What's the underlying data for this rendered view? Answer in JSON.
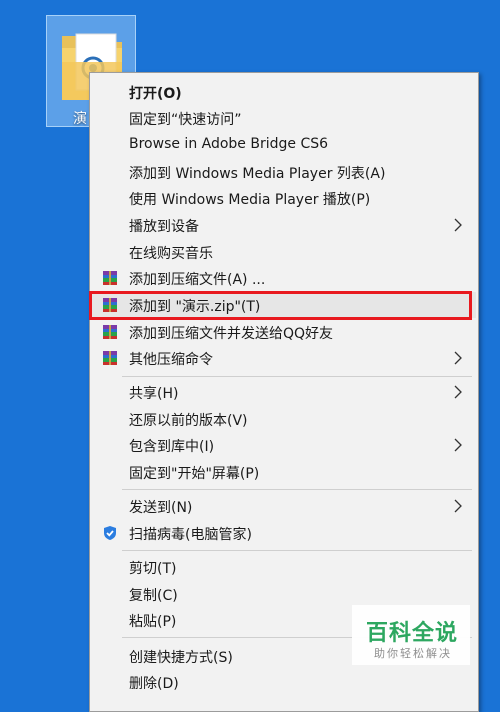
{
  "desktop": {
    "folder_label": "演"
  },
  "menu": {
    "items": [
      {
        "label": "打开(O)",
        "bold": true
      },
      {
        "label": "固定到“快速访问”"
      },
      {
        "label": "Browse in Adobe Bridge CS6"
      },
      {
        "label": "添加到 Windows Media Player 列表(A)"
      },
      {
        "label": "使用 Windows Media Player 播放(P)"
      },
      {
        "label": "播放到设备"
      },
      {
        "label": "在线购买音乐"
      },
      {
        "label": "添加到压缩文件(A) ..."
      },
      {
        "label": "添加到 \"演示.zip\"(T)"
      },
      {
        "label": "添加到压缩文件并发送给QQ好友"
      },
      {
        "label": "其他压缩命令"
      },
      {
        "label": "共享(H)"
      },
      {
        "label": "还原以前的版本(V)"
      },
      {
        "label": "包含到库中(I)"
      },
      {
        "label": "固定到\"开始\"屏幕(P)"
      },
      {
        "label": "发送到(N)"
      },
      {
        "label": "扫描病毒(电脑管家)"
      },
      {
        "label": "剪切(T)"
      },
      {
        "label": "复制(C)"
      },
      {
        "label": "粘贴(P)"
      },
      {
        "label": "创建快捷方式(S)"
      },
      {
        "label": "删除(D)"
      }
    ],
    "highlighted_index": 8
  },
  "watermark": {
    "title": "百科全说",
    "subtitle": "助你轻松解决"
  },
  "colors": {
    "desktop": "#1a73d6",
    "menu_bg": "#f2f2f2",
    "highlight_border": "#e8191f",
    "watermark_green": "#26a45b"
  }
}
